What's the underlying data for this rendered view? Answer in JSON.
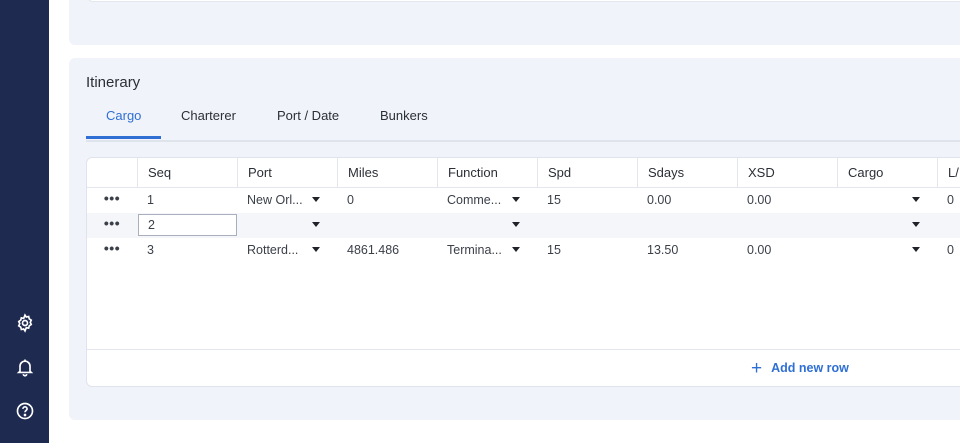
{
  "sidebar": {
    "icons": [
      "gear-icon",
      "bell-icon",
      "help-icon"
    ]
  },
  "itinerary": {
    "title": "Itinerary",
    "tabs": [
      {
        "label": "Cargo",
        "active": true
      },
      {
        "label": "Charterer",
        "active": false
      },
      {
        "label": "Port / Date",
        "active": false
      },
      {
        "label": "Bunkers",
        "active": false
      }
    ],
    "columns": [
      "Seq",
      "Port",
      "Miles",
      "Function",
      "Spd",
      "Sdays",
      "XSD",
      "Cargo",
      "L/"
    ],
    "rows": [
      {
        "seq": "1",
        "port": "New Orl...",
        "miles": "0",
        "function": "Comme...",
        "spd": "15",
        "sdays": "0.00",
        "xsd": "0.00",
        "cargo": "",
        "l": "0"
      },
      {
        "seq": "2",
        "port": "",
        "miles": "",
        "function": "",
        "spd": "",
        "sdays": "",
        "xsd": "",
        "cargo": "",
        "l": ""
      },
      {
        "seq": "3",
        "port": "Rotterd...",
        "miles": "4861.486",
        "function": "Termina...",
        "spd": "15",
        "sdays": "13.50",
        "xsd": "0.00",
        "cargo": "",
        "l": "0"
      }
    ],
    "add_row_label": "Add new row",
    "accent": "#2f6fd4"
  }
}
